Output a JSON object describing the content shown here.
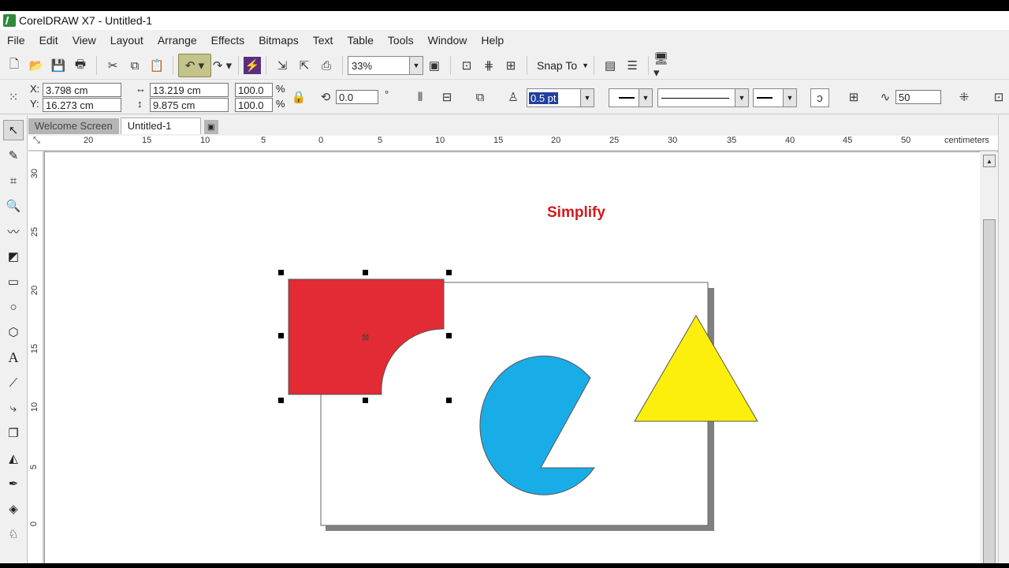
{
  "window": {
    "title": "CorelDRAW X7 - Untitled-1"
  },
  "menu": [
    "File",
    "Edit",
    "View",
    "Layout",
    "Arrange",
    "Effects",
    "Bitmaps",
    "Text",
    "Table",
    "Tools",
    "Window",
    "Help"
  ],
  "toolbar": {
    "zoom": "33%",
    "snap_label": "Snap To"
  },
  "property_bar": {
    "x_label": "X:",
    "x_value": "3.798 cm",
    "y_label": "Y:",
    "y_value": "16.273 cm",
    "width": "13.219 cm",
    "height": "9.875 cm",
    "scale_x": "100.0",
    "scale_y": "100.0",
    "percent": "%",
    "angle": "0.0",
    "degree": "°",
    "outline_width": "0.5 pt",
    "smoothing": "50"
  },
  "tabs": {
    "welcome": "Welcome Screen",
    "document": "Untitled-1"
  },
  "ruler": {
    "unit": "centimeters",
    "h_ticks": [
      "20",
      "15",
      "10",
      "5",
      "0",
      "5",
      "10",
      "15",
      "20",
      "25",
      "30",
      "35",
      "40",
      "45",
      "50"
    ],
    "v_ticks": [
      "30",
      "25",
      "20",
      "15",
      "10",
      "5",
      "0"
    ]
  },
  "canvas": {
    "heading": "Simplify"
  },
  "colors": {
    "red": "#e22b34",
    "blue": "#19ade8",
    "yellow": "#fcef0b",
    "heading": "#d11a1a",
    "shadow": "#808080"
  }
}
